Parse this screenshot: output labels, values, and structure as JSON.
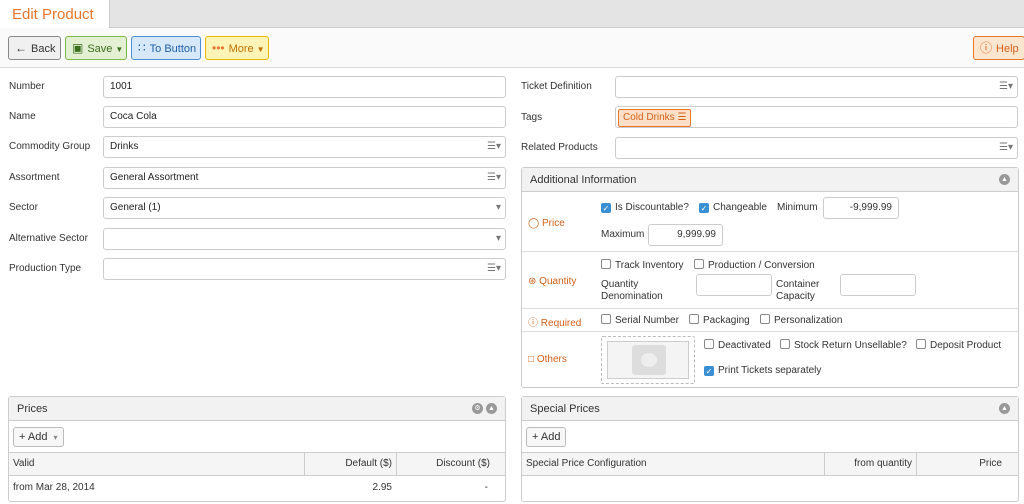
{
  "tab": {
    "title": "Edit Product"
  },
  "toolbar": {
    "back": "Back",
    "save": "Save",
    "to_button": "To Button",
    "more": "More",
    "help": "Help"
  },
  "form": {
    "number_label": "Number",
    "number_value": "1001",
    "name_label": "Name",
    "name_value": "Coca Cola",
    "commodity_label": "Commodity Group",
    "commodity_value": "Drinks",
    "assortment_label": "Assortment",
    "assortment_value": "General Assortment",
    "sector_label": "Sector",
    "sector_value": "General (1)",
    "alt_sector_label": "Alternative Sector",
    "alt_sector_value": "",
    "production_type_label": "Production Type",
    "production_type_value": "",
    "ticket_label": "Ticket Definition",
    "ticket_value": "",
    "tags_label": "Tags",
    "tag_cold_drinks": "Cold Drinks",
    "related_label": "Related Products",
    "related_value": ""
  },
  "additional": {
    "title": "Additional Information",
    "price_label": "Price",
    "is_discountable": "Is Discountable?",
    "changeable": "Changeable",
    "minimum_label": "Minimum",
    "minimum_value": "-9,999.99",
    "maximum_label": "Maximum",
    "maximum_value": "9,999.99",
    "quantity_label": "Quantity",
    "track_inventory": "Track Inventory",
    "production_conversion": "Production / Conversion",
    "quantity_denom_1": "Quantity",
    "quantity_denom_2": "Denomination",
    "container_1": "Container",
    "container_2": "Capacity",
    "required_label": "Required",
    "serial_number": "Serial Number",
    "packaging": "Packaging",
    "personalization": "Personalization",
    "others_label": "Others",
    "deactivated": "Deactivated",
    "stock_return": "Stock Return Unsellable?",
    "deposit_product": "Deposit Product",
    "print_tickets": "Print Tickets separately"
  },
  "prices": {
    "title": "Prices",
    "add": "Add",
    "columns": [
      "Valid",
      "Default ($)",
      "Discount ($)"
    ],
    "rows": [
      [
        "from Mar 28, 2014",
        "2.95",
        "-"
      ]
    ]
  },
  "special_prices": {
    "title": "Special Prices",
    "add": "Add",
    "columns": [
      "Special Price Configuration",
      "from quantity",
      "Price"
    ]
  },
  "colors": {
    "accent": "#e8762d",
    "checkbox": "#3a8fd4"
  }
}
